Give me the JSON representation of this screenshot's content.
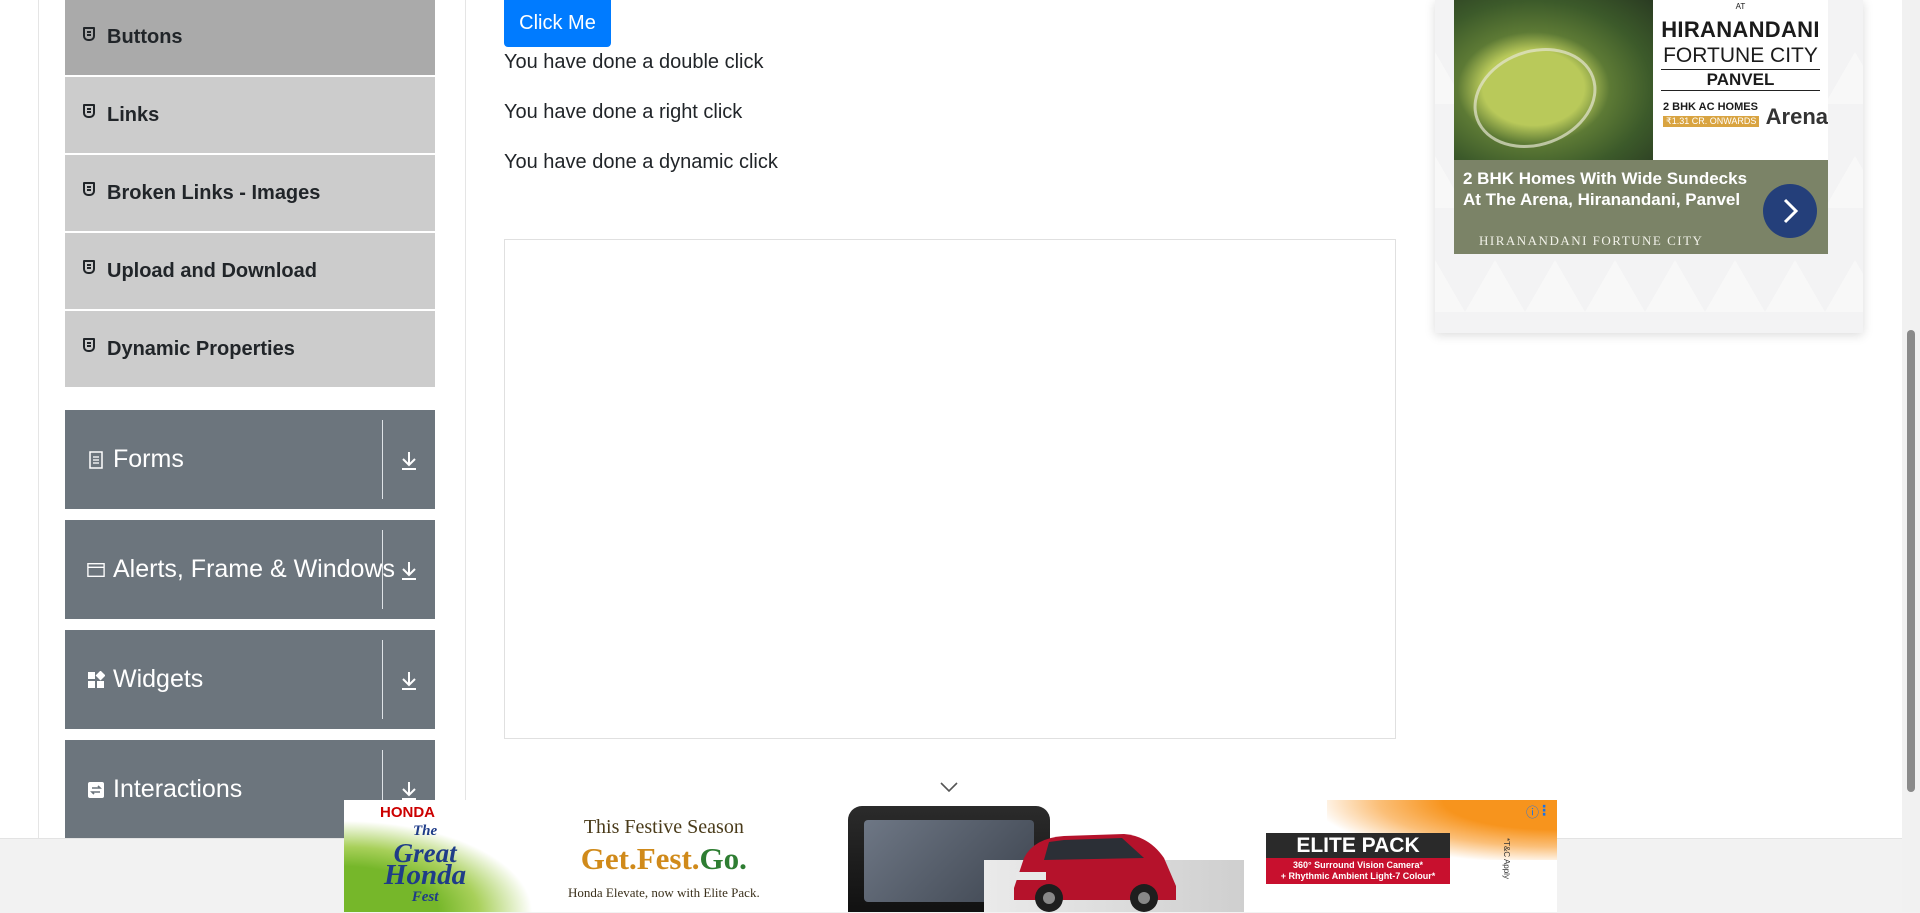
{
  "sidebar": {
    "elements_items": [
      {
        "label": "Buttons",
        "active": true
      },
      {
        "label": "Links"
      },
      {
        "label": "Broken Links - Images"
      },
      {
        "label": "Upload and Download"
      },
      {
        "label": "Dynamic Properties"
      }
    ],
    "groups": [
      {
        "label": "Forms",
        "icon": "document-icon"
      },
      {
        "label": "Alerts, Frame & Windows",
        "icon": "window-icon"
      },
      {
        "label": "Widgets",
        "icon": "widgets-icon"
      },
      {
        "label": "Interactions",
        "icon": "interactions-icon"
      }
    ]
  },
  "main": {
    "click_button_label": "Click Me",
    "messages": {
      "double": "You have done a double click",
      "right": "You have done a right click",
      "dynamic": "You have done a dynamic click"
    }
  },
  "side_ad": {
    "at_label": "AT",
    "brand_line1": "HIRANANDANI",
    "brand_line2": "FORTUNE CITY",
    "brand_line3": "PANVEL",
    "homes_tag": "2 BHK AC HOMES",
    "price_tag": "₹1.31 CR. ONWARDS",
    "arena": "Arena",
    "headline_line1": "2 BHK Homes With Wide Sundecks",
    "headline_line2": "At The Arena, Hiranandani, Panvel",
    "subbrand": "HIRANANDANI FORTUNE CITY"
  },
  "bottom_ad": {
    "honda": "HONDA",
    "great_line1": "The",
    "great_line2": "Great",
    "great_line3": "Honda",
    "great_line4": "Fest",
    "festive_line1": "This Festive Season",
    "festive_get": "Get.Fest.",
    "festive_go": "Go.",
    "festive_line3": "Honda Elevate, now with Elite Pack.",
    "elite_title": "ELITE PACK",
    "elite_line1": "360° Surround Vision Camera*",
    "elite_line2": "+ Rhythmic Ambient Light-7 Colour*",
    "fine_print": "*T&C Apply"
  },
  "colors": {
    "primary": "#007bff",
    "group_bg": "#6c757d",
    "sub_bg": "#cccccc",
    "sub_active_bg": "#aaaaaa"
  }
}
